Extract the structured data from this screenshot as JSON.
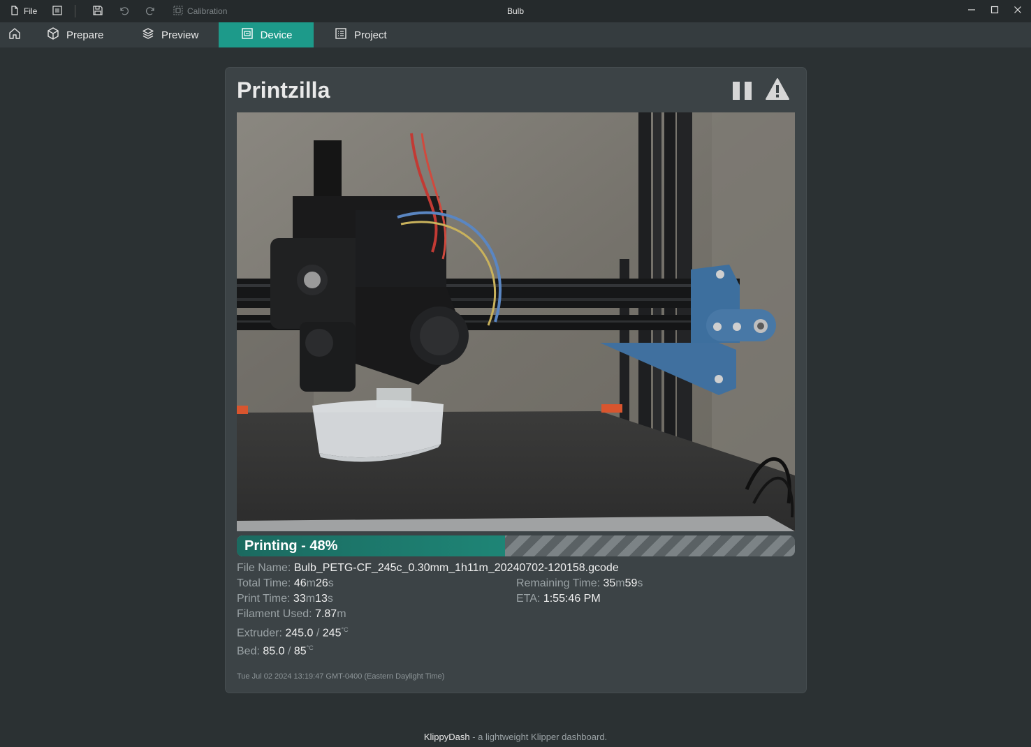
{
  "titlebar": {
    "file_label": "File",
    "calibration_label": "Calibration",
    "window_title": "Bulb"
  },
  "nav": {
    "tabs": [
      {
        "label": "Prepare",
        "icon": "cube-icon"
      },
      {
        "label": "Preview",
        "icon": "layers-icon"
      },
      {
        "label": "Device",
        "icon": "device-icon",
        "active": true
      },
      {
        "label": "Project",
        "icon": "project-icon"
      }
    ],
    "accent": "#1d9a8a"
  },
  "card": {
    "printer_name": "Printzilla",
    "status": "Printing - 48%",
    "progress": 0.48,
    "file_name_label": "File Name:",
    "file_name": "Bulb_PETG-CF_245c_0.30mm_1h11m_20240702-120158.gcode",
    "total_time_label": "Total Time:",
    "total_time": {
      "min": "46",
      "m": "m",
      "sec": "26",
      "s": "s"
    },
    "remaining_time_label": "Remaining Time:",
    "remaining_time": {
      "min": "35",
      "m": "m",
      "sec": "59",
      "s": "s"
    },
    "print_time_label": "Print Time:",
    "print_time": {
      "min": "33",
      "m": "m",
      "sec": "13",
      "s": "s"
    },
    "eta_label": "ETA:",
    "eta": "1:55:46 PM",
    "filament_label": "Filament Used:",
    "filament": "7.87",
    "filament_unit": "m",
    "extruder_label": "Extruder:",
    "extruder_current": "245.0",
    "extruder_target": "245",
    "bed_label": "Bed:",
    "bed_current": "85.0",
    "bed_target": "85",
    "slash": " / ",
    "temp_unit": "°C",
    "timestamp": "Tue Jul 02 2024 13:19:47 GMT-0400 (Eastern Daylight Time)"
  },
  "footer": {
    "brand": "KlippyDash",
    "tagline": " - a lightweight Klipper dashboard."
  }
}
